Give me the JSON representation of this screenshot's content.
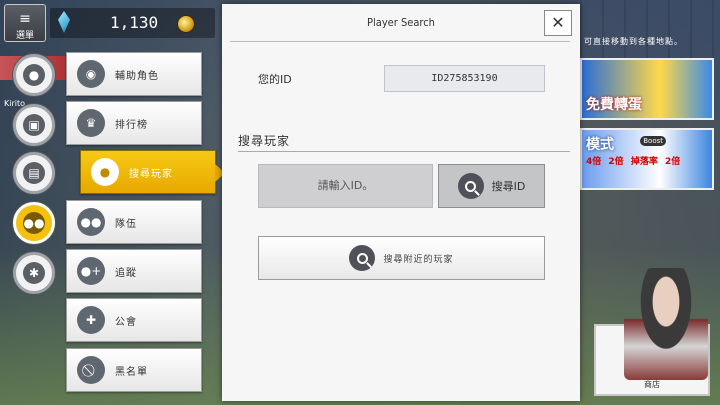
{
  "hud": {
    "menu_label": "選單",
    "currency_amount": "1,130",
    "player_name": "Kirito"
  },
  "side_buttons": [
    {
      "name": "profile-icon",
      "glyph": "👤"
    },
    {
      "name": "bag-icon",
      "glyph": "👜"
    },
    {
      "name": "notes-icon",
      "glyph": "📄"
    },
    {
      "name": "friends-icon",
      "glyph": "👥"
    },
    {
      "name": "gear-icon",
      "glyph": "⚙"
    }
  ],
  "submenu": {
    "items": [
      {
        "label": "輔助角色",
        "icon": "eye-icon"
      },
      {
        "label": "排行榜",
        "icon": "crown-icon"
      },
      {
        "label": "搜尋玩家",
        "icon": "person-search-icon"
      },
      {
        "label": "隊伍",
        "icon": "party-icon"
      },
      {
        "label": "追蹤",
        "icon": "follow-icon"
      },
      {
        "label": "公會",
        "icon": "guild-icon"
      },
      {
        "label": "黑名單",
        "icon": "block-icon"
      }
    ]
  },
  "dialog": {
    "title": "Player Search",
    "close": "✕",
    "id_label": "您的ID",
    "id_value": "ID275853190",
    "section_label": "搜尋玩家",
    "input_placeholder": "請輸入ID。",
    "search_id_label": "搜尋ID",
    "nearby_label": "搜尋附近的玩家"
  },
  "banners": {
    "top_strip": "可直接移動到各種地點。",
    "gacha_label": "免費轉蛋",
    "mode_label": "模式",
    "rates": [
      "4倍",
      "2倍",
      "掉落率",
      "2倍"
    ],
    "boost_tag": "Boost"
  },
  "shop": {
    "label": "商店"
  }
}
